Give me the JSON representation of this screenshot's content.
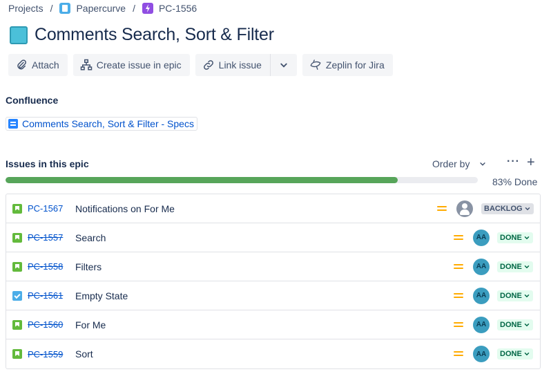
{
  "breadcrumb": {
    "projects": "Projects",
    "separator": "/",
    "project_name": "Papercurve",
    "epic_key": "PC-1556"
  },
  "title": "Comments Search, Sort & Filter",
  "toolbar": {
    "attach": "Attach",
    "create_issue": "Create issue in epic",
    "link_issue": "Link issue",
    "zeplin": "Zeplin for Jira"
  },
  "confluence": {
    "heading": "Confluence",
    "page_link": "Comments Search, Sort & Filter - Specs"
  },
  "issues": {
    "heading": "Issues in this epic",
    "order_by": "Order by",
    "progress_percent": 83,
    "progress_label": "83% Done",
    "rows": [
      {
        "type": "story",
        "key": "PC-1567",
        "summary": "Notifications on For Me",
        "priority": "medium",
        "assignee": "",
        "status": "BACKLOG",
        "done": false
      },
      {
        "type": "story",
        "key": "PC-1557",
        "summary": "Search",
        "priority": "medium",
        "assignee": "AA",
        "status": "DONE",
        "done": true
      },
      {
        "type": "story",
        "key": "PC-1558",
        "summary": "Filters",
        "priority": "medium",
        "assignee": "AA",
        "status": "DONE",
        "done": true
      },
      {
        "type": "task",
        "key": "PC-1561",
        "summary": "Empty State",
        "priority": "medium",
        "assignee": "AA",
        "status": "DONE",
        "done": true
      },
      {
        "type": "story",
        "key": "PC-1560",
        "summary": "For Me",
        "priority": "medium",
        "assignee": "AA",
        "status": "DONE",
        "done": true
      },
      {
        "type": "story",
        "key": "PC-1559",
        "summary": "Sort",
        "priority": "medium",
        "assignee": "AA",
        "status": "DONE",
        "done": true
      }
    ]
  },
  "colors": {
    "progress": "#57a55a",
    "link": "#0052cc",
    "priority_medium": "#ffab00",
    "done_bg": "#e3fcef",
    "done_text": "#006644"
  }
}
